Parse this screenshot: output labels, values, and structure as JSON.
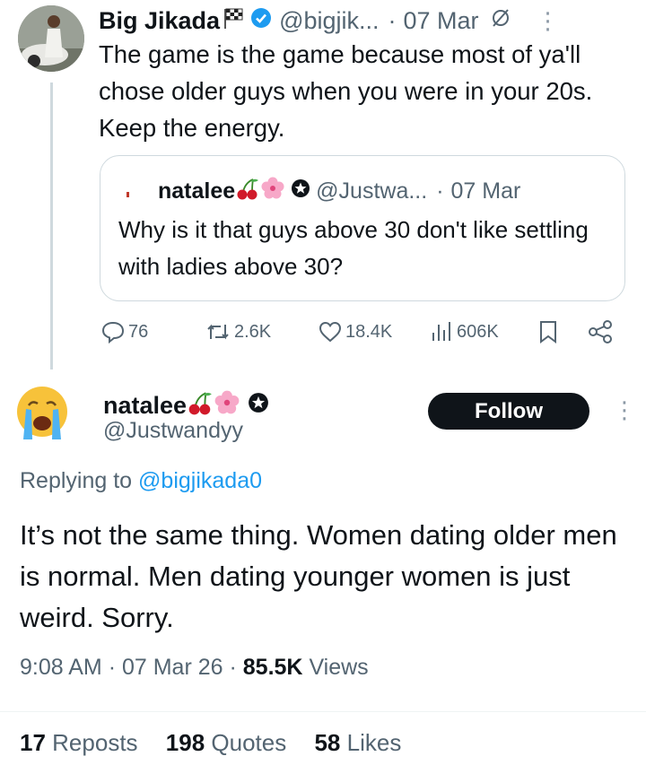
{
  "tweet": {
    "author_name": "Big Jikada",
    "author_handle": "@bigjik...",
    "separator": "·",
    "date": "07 Mar",
    "text": "The game is the game because most of ya'll chose older guys when you were in your 20s. Keep the energy.",
    "quote": {
      "author_name": "natalee",
      "author_handle": "@Justwa...",
      "date": "07 Mar",
      "text": "Why is it that guys above 30 don't like settling with ladies above 30?"
    },
    "actions": {
      "replies": "76",
      "reposts": "2.6K",
      "likes": "18.4K",
      "views": "606K"
    }
  },
  "reply": {
    "author_name": "natalee",
    "author_handle": "@Justwandyy",
    "follow_label": "Follow",
    "replying_prefix": "Replying to",
    "replying_to": "@bigjikada0",
    "text": "It’s not the same thing. Women dating older men is normal. Men dating younger women is just weird. Sorry.",
    "time": "9:08 AM",
    "date": "07 Mar 26",
    "views_count": "85.5K",
    "views_label": "Views",
    "reposts_count": "17",
    "reposts_label": "Reposts",
    "quotes_count": "198",
    "quotes_label": "Quotes",
    "likes_count": "58",
    "likes_label": "Likes"
  },
  "icons": {
    "checkered_flag": "checkered-flag-icon",
    "verified": "verified-badge-icon",
    "muted": "muted-icon",
    "cherries": "cherries-icon",
    "blossom": "blossom-icon",
    "star_badge": "star-badge-icon",
    "crying_face": "crying-face-icon"
  },
  "colors": {
    "accent": "#1d9bf0",
    "text": "#0f1419",
    "muted": "#536471",
    "border": "#cfd9de"
  }
}
